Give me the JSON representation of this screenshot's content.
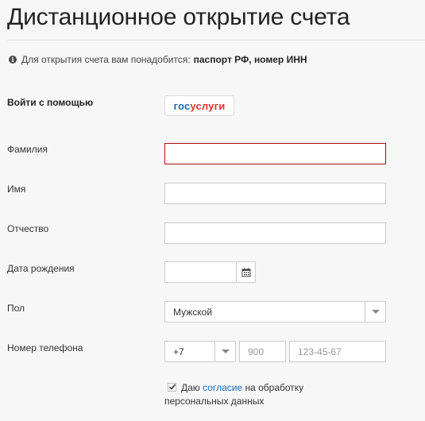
{
  "page": {
    "title": "Дистанционное открытие счета"
  },
  "info": {
    "icon": "info-icon",
    "text": "Для открытия счета вам понадобится:",
    "bold": "паспорт РФ, номер ИНН"
  },
  "login": {
    "label": "Войти с помощью",
    "gosuslugi_part1": "гос",
    "gosuslugi_part2": "услуги",
    "colors": {
      "blue": "#1a6aa9",
      "red": "#e3342f"
    }
  },
  "form": {
    "surname": {
      "label": "Фамилия",
      "value": "",
      "state": "error",
      "error_color": "#a30d10"
    },
    "name": {
      "label": "Имя",
      "value": ""
    },
    "patronymic": {
      "label": "Отчество",
      "value": ""
    },
    "birthdate": {
      "label": "Дата рождения",
      "value": "",
      "icon": "calendar-icon"
    },
    "gender": {
      "label": "Пол",
      "selected": "Мужской",
      "icon": "chevron-down-icon"
    },
    "phone": {
      "label": "Номер телефона",
      "country_code": "+7",
      "area_placeholder": "900",
      "number_placeholder": "123-45-67"
    }
  },
  "consent": {
    "checked": true,
    "text_before": "Даю",
    "link": "согласие",
    "text_after": "на обработку",
    "line2": "персональных данных",
    "link_color": "#1d68b2"
  }
}
